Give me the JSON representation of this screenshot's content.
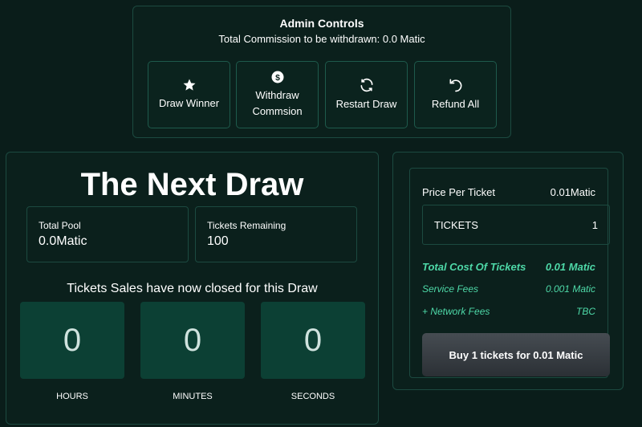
{
  "admin": {
    "title": "Admin Controls",
    "commission": "Total Commission to be withdrawn: 0.0 Matic",
    "buttons": {
      "draw": "Draw Winner",
      "withdraw_line1": "Withdraw",
      "withdraw_line2": "Commsion",
      "restart": "Restart Draw",
      "refund": "Refund All"
    },
    "icons": [
      "star-icon",
      "dollar-icon",
      "refresh-icon",
      "undo-icon"
    ]
  },
  "draw": {
    "heading": "The Next Draw",
    "pool_label": "Total Pool",
    "pool_value": "0.0Matic",
    "tickets_label": "Tickets Remaining",
    "tickets_value": "100",
    "closed_message": "Tickets Sales have now closed for this Draw",
    "countdown": {
      "hours": "0",
      "minutes": "0",
      "seconds": "0",
      "hours_label": "HOURS",
      "minutes_label": "MINUTES",
      "seconds_label": "SECONDS"
    }
  },
  "purchase": {
    "price_label": "Price Per Ticket",
    "price_value": "0.01Matic",
    "tickets_label": "TICKETS",
    "tickets_value": "1",
    "total_label": "Total Cost Of Tickets",
    "total_value": "0.01 Matic",
    "service_label": "Service Fees",
    "service_value": "0.001 Matic",
    "network_label": "+ Network Fees",
    "network_value": "TBC",
    "buy_button": "Buy 1 tickets for 0.01 Matic"
  },
  "colors": {
    "background": "#0a1d1a",
    "accent": "#4ed9a8",
    "countdown_box": "#0c4034"
  }
}
